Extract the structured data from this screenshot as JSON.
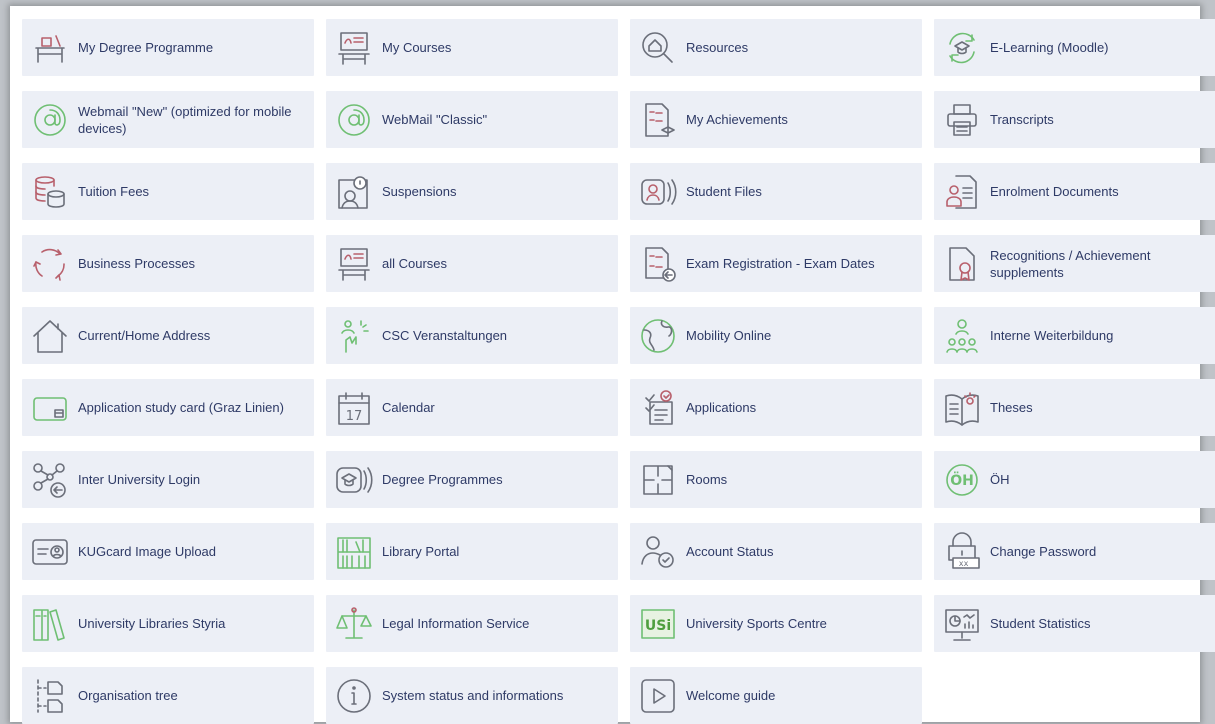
{
  "colors": {
    "tile_bg": "#eceff6",
    "text": "#2e3a66",
    "icon_gray": "#6b6f7a",
    "icon_green": "#6fbf73",
    "icon_red": "#b8606c"
  },
  "tiles": [
    {
      "label": "My Degree Programme",
      "icon": "desk-icon"
    },
    {
      "label": "My Courses",
      "icon": "blackboard-icon"
    },
    {
      "label": "Resources",
      "icon": "search-home-icon"
    },
    {
      "label": "E-Learning (Moodle)",
      "icon": "elearning-icon"
    },
    {
      "label": "Webmail \"New\" (optimized for mobile devices)",
      "icon": "at-icon"
    },
    {
      "label": "WebMail \"Classic\"",
      "icon": "at-icon"
    },
    {
      "label": "My Achievements",
      "icon": "grades-icon"
    },
    {
      "label": "Transcripts",
      "icon": "printer-icon"
    },
    {
      "label": "Tuition Fees",
      "icon": "coins-icon"
    },
    {
      "label": "Suspensions",
      "icon": "person-lock-icon"
    },
    {
      "label": "Student Files",
      "icon": "student-files-icon"
    },
    {
      "label": "Enrolment Documents",
      "icon": "enrolment-docs-icon"
    },
    {
      "label": "Business Processes",
      "icon": "cycle-icon"
    },
    {
      "label": "all Courses",
      "icon": "blackboard-icon"
    },
    {
      "label": "Exam Registration - Exam Dates",
      "icon": "exam-register-icon"
    },
    {
      "label": "Recognitions / Achievement supplements",
      "icon": "certificate-icon"
    },
    {
      "label": "Current/Home Address",
      "icon": "house-icon"
    },
    {
      "label": "CSC Veranstaltungen",
      "icon": "csc-icon"
    },
    {
      "label": "Mobility Online",
      "icon": "globe-icon"
    },
    {
      "label": "Interne Weiterbildung",
      "icon": "group-training-icon"
    },
    {
      "label": "Application study card (Graz Linien)",
      "icon": "card-icon"
    },
    {
      "label": "Calendar",
      "icon": "calendar-icon",
      "day": "17"
    },
    {
      "label": "Applications",
      "icon": "applications-icon"
    },
    {
      "label": "Theses",
      "icon": "thesis-icon"
    },
    {
      "label": "Inter University Login",
      "icon": "network-login-icon"
    },
    {
      "label": "Degree Programmes",
      "icon": "degree-programmes-icon"
    },
    {
      "label": "Rooms",
      "icon": "floorplan-icon"
    },
    {
      "label": "ÖH",
      "icon": "oeh-icon",
      "text": "ÖH"
    },
    {
      "label": "KUGcard Image Upload",
      "icon": "id-card-icon"
    },
    {
      "label": "Library Portal",
      "icon": "library-icon"
    },
    {
      "label": "Account Status",
      "icon": "account-status-icon"
    },
    {
      "label": "Change Password",
      "icon": "password-lock-icon"
    },
    {
      "label": "University Libraries Styria",
      "icon": "books-icon"
    },
    {
      "label": "Legal Information Service",
      "icon": "scales-icon"
    },
    {
      "label": "University Sports Centre",
      "icon": "usi-logo-icon",
      "text": "USi"
    },
    {
      "label": "Student Statistics",
      "icon": "statistics-icon"
    },
    {
      "label": "Organisation tree",
      "icon": "tree-icon"
    },
    {
      "label": "System status and informations",
      "icon": "info-icon"
    },
    {
      "label": "Welcome guide",
      "icon": "play-icon"
    }
  ]
}
